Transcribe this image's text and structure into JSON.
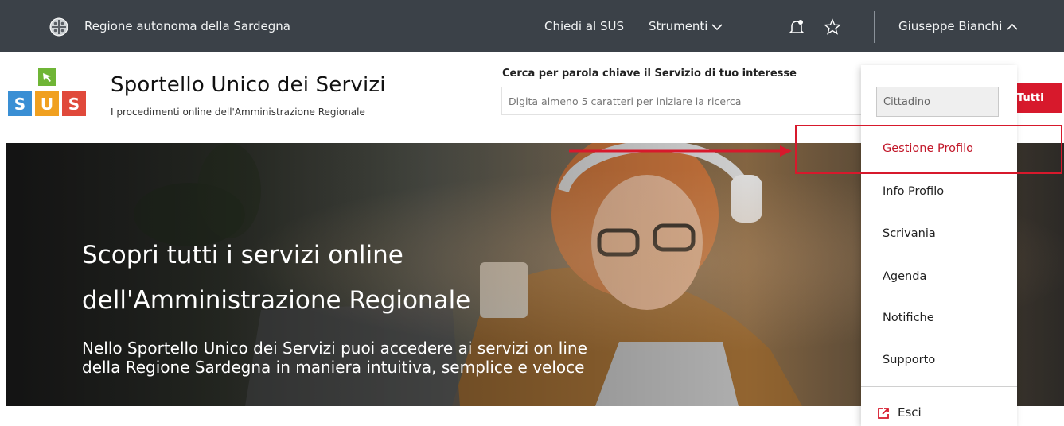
{
  "topbar": {
    "region_name": "Regione autonoma della Sardegna",
    "nav_chiedi": "Chiedi al SUS",
    "nav_strumenti": "Strumenti",
    "user_name": "Giuseppe Bianchi",
    "icons": [
      "sardinia-emblem-icon",
      "chevron-down-icon",
      "bell-icon",
      "star-icon",
      "chevron-up-icon"
    ]
  },
  "header": {
    "logo_letters": [
      "S",
      "U",
      "S"
    ],
    "title": "Sportello Unico dei Servizi",
    "subtitle": "I procedimenti online dell'Amministrazione Regionale",
    "search_label": "Cerca per parola chiave il Servizio di tuo interesse",
    "search_placeholder": "Digita almeno 5 caratteri per iniziare la ricerca",
    "tutti_button": "Tutti"
  },
  "hero": {
    "title_line1": "Scopri tutti i servizi online",
    "title_line2": "dell'Amministrazione Regionale",
    "subtitle_line1": "Nello Sportello Unico dei Servizi puoi accedere ai servizi on line",
    "subtitle_line2": "della Regione Sardegna in maniera intuitiva, semplice e veloce"
  },
  "user_menu": {
    "role_value": "Cittadino",
    "items": [
      {
        "label": "Gestione Profilo",
        "active": true
      },
      {
        "label": "Info Profilo"
      },
      {
        "label": "Scrivania"
      },
      {
        "label": "Agenda"
      },
      {
        "label": "Notifiche"
      },
      {
        "label": "Supporto"
      }
    ],
    "logout_label": "Esci"
  },
  "colors": {
    "topbar_bg": "#3b4148",
    "accent_red": "#d7192c",
    "logo_green": "#6fb536",
    "logo_blue": "#3a8fd4",
    "logo_orange": "#f0a020"
  }
}
